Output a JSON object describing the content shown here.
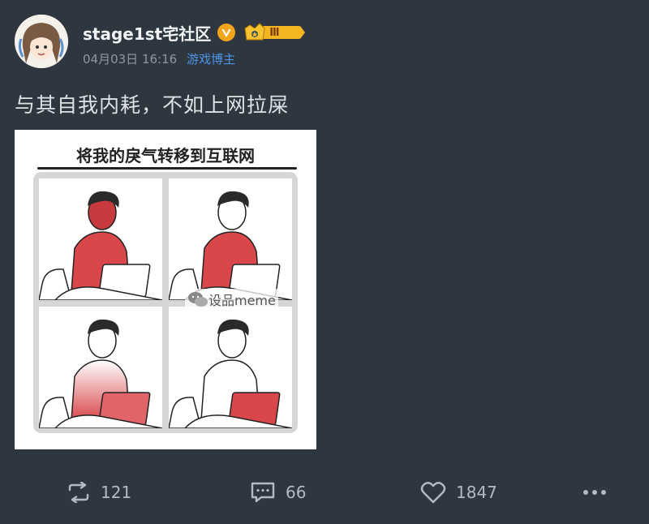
{
  "post": {
    "author": {
      "username": "stage1st宅社区",
      "role": "游戏博主",
      "level_badge": "Ⅲ"
    },
    "timestamp": "04月03日 16:16",
    "text": "与其自我内耗，不如上网拉屎",
    "image": {
      "meme_title": "将我的戾气转移到互联网",
      "watermark": "设品meme"
    }
  },
  "actions": {
    "repost_count": "121",
    "comment_count": "66",
    "like_count": "1847"
  },
  "colors": {
    "background": "#2e373f",
    "link_blue": "#4d94e8",
    "badge_gold": "#f1a51a",
    "anger_red": "#d9474b"
  },
  "icons": [
    "avatar",
    "verified-icon",
    "crown-icon",
    "repost-icon",
    "comment-icon",
    "like-icon",
    "more-icon",
    "wechat-icon"
  ]
}
